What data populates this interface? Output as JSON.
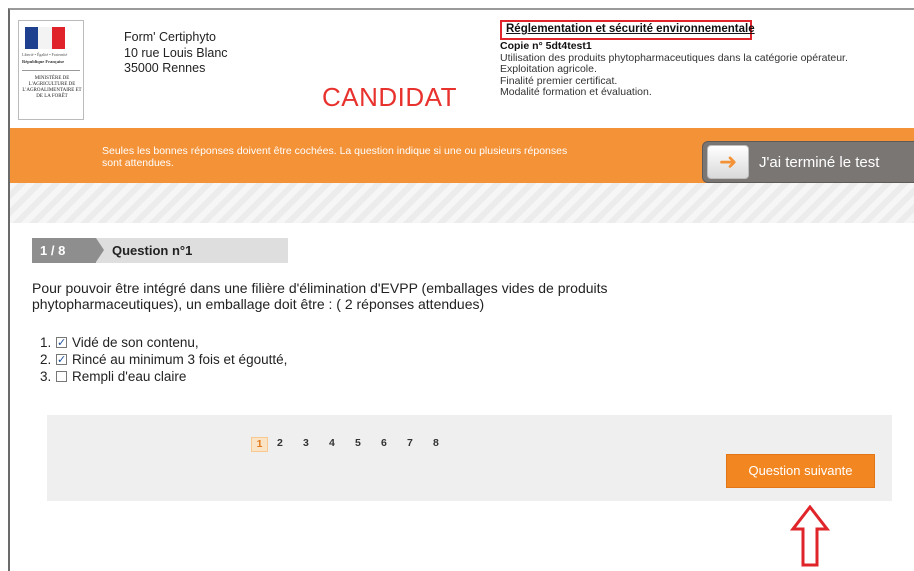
{
  "header": {
    "logo": {
      "motto": "Liberté • Égalité • Fraternité",
      "republique": "République Française",
      "ministry": "MINISTÈRE DE L'AGRICULTURE DE L'AGROALIMENTAIRE ET DE LA FORÊT"
    },
    "org_name": "Form' Certiphyto",
    "org_street": "10 rue Louis Blanc",
    "org_city": "35000 Rennes",
    "role": "CANDIDAT",
    "module_title": "Réglementation et sécurité environnementale",
    "copie": "Copie n° 5dt4test1",
    "info_line1": "Utilisation des produits phytopharmaceutiques dans la catégorie opérateur.",
    "info_line2": "Exploitation agricole.",
    "info_line3": "Finalité premier certificat.",
    "info_line4": "Modalité formation et évaluation."
  },
  "banner": {
    "instructions": "Seules les bonnes réponses doivent être cochées. La question indique si une ou plusieurs réponses sont attendues.",
    "finish_label": "J'ai terminé le test"
  },
  "question": {
    "counter": "1 / 8",
    "title": "Question n°1",
    "text": "Pour pouvoir être intégré dans une filière d'élimination d'EVPP (emballages vides de produits phytopharmaceutiques), un emballage doit être : ( 2 réponses attendues)",
    "answers": [
      {
        "num": "1.",
        "label": "Vidé de son contenu,",
        "checked": true
      },
      {
        "num": "2.",
        "label": "Rincé au minimum 3 fois et égoutté,",
        "checked": true
      },
      {
        "num": "3.",
        "label": "Rempli d'eau claire",
        "checked": false
      }
    ]
  },
  "pagination": {
    "pages": [
      "1",
      "2",
      "3",
      "4",
      "5",
      "6",
      "7",
      "8"
    ],
    "current": "1"
  },
  "next_button": "Question suivante",
  "colors": {
    "accent_orange": "#f39237",
    "highlight_red": "#e0252a",
    "candidat_red": "#e8322e"
  }
}
